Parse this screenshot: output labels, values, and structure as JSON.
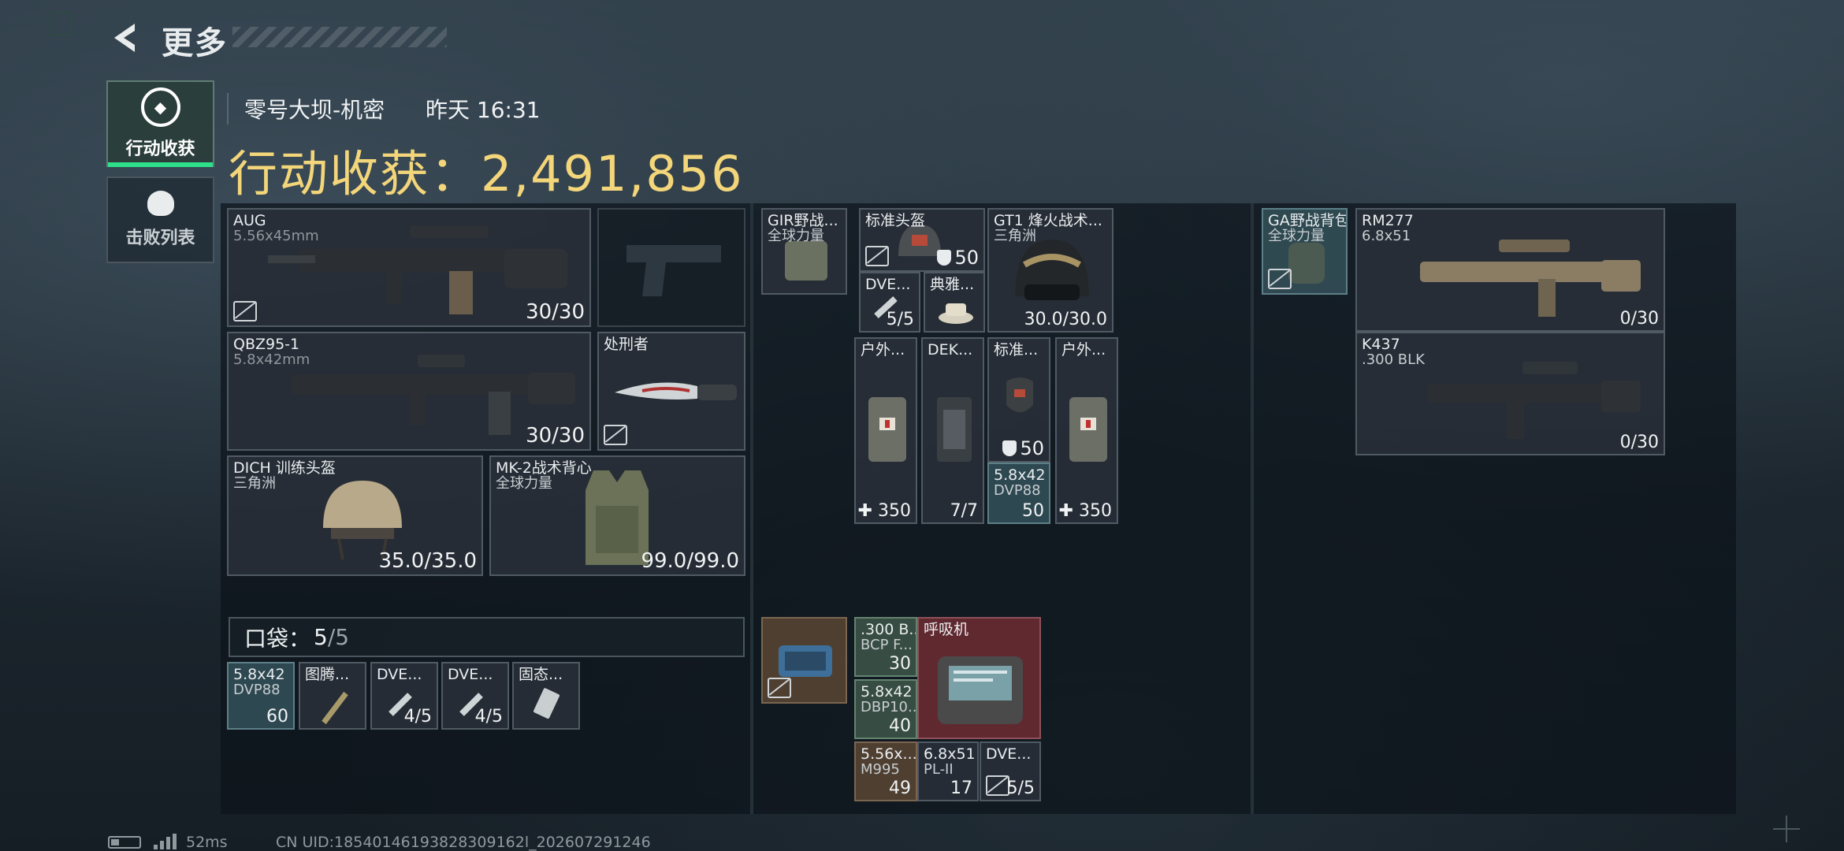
{
  "header": {
    "title": "更多"
  },
  "sidebar": {
    "tabs": [
      {
        "label": "行动收获",
        "active": true
      },
      {
        "label": "击败列表",
        "active": false
      }
    ]
  },
  "match": {
    "map": "零号大坝-机密",
    "time": "昨天 16:31"
  },
  "loot": {
    "label": "行动收获：",
    "value": "2,491,856"
  },
  "colors": {
    "accent": "#2fe08a",
    "gold": "#f3d57a",
    "red_slot": "#6e2d32"
  },
  "loadout": {
    "primary_1": {
      "name": "AUG",
      "caliber": "5.56x45mm",
      "ammo": "30/30"
    },
    "primary_2": {
      "name": "QBZ95-1",
      "caliber": "5.8x42mm",
      "ammo": "30/30"
    },
    "melee": {
      "name": "处刑者"
    },
    "helmet": {
      "name": "DICH 训练头盔",
      "brand": "三角洲",
      "durability": "35.0/35.0"
    },
    "armor": {
      "name": "MK-2战术背心",
      "brand": "全球力量",
      "durability": "99.0/99.0"
    }
  },
  "pocket": {
    "label": "口袋：",
    "value": "5",
    "max": "/5",
    "items": [
      {
        "name": "5.8x42",
        "sub": "DVP88",
        "count": "60"
      },
      {
        "name": "图腾...",
        "sub": "",
        "count": ""
      },
      {
        "name": "DVE...",
        "sub": "",
        "count": "4/5"
      },
      {
        "name": "DVE...",
        "sub": "",
        "count": "4/5"
      },
      {
        "name": "固态...",
        "sub": "",
        "count": ""
      }
    ]
  },
  "chest": {
    "rig": {
      "name": "GIR野战...",
      "brand": "全球力量"
    },
    "helmet_std": {
      "name": "标准头盔",
      "armor": "50"
    },
    "gt1": {
      "name": "GT1 烽火战术...",
      "brand": "三角洲",
      "durability": "30.0/30.0"
    },
    "dve": {
      "name": "DVE...",
      "count": "5/5"
    },
    "dianya": {
      "name": "典雅..."
    },
    "kits": [
      {
        "name": "户外...",
        "count": "350"
      },
      {
        "name": "DEK...",
        "count": "7/7"
      },
      {
        "name": "标准...",
        "armor": "50",
        "ammo_name": "5.8x42",
        "ammo_sub": "DVP88",
        "count": "50"
      },
      {
        "name": "户外...",
        "count": "350"
      }
    ]
  },
  "secure": {
    "case": {
      "name": "",
      "sub": ""
    },
    "ammo_300": {
      "name": ".300 B...",
      "sub": "BCP F...",
      "count": "30"
    },
    "respirator": {
      "name": "呼吸机"
    },
    "ammo_58": {
      "name": "5.8x42",
      "sub": "DBP10...",
      "count": "40"
    },
    "small": [
      {
        "name": "5.56x...",
        "sub": "M995",
        "count": "49"
      },
      {
        "name": "6.8x51",
        "sub": "PL-II",
        "count": "17"
      },
      {
        "name": "DVE...",
        "sub": "",
        "count": "5/5"
      }
    ]
  },
  "backpack": {
    "bag": {
      "name": "GA野战背包",
      "brand": "全球力量"
    },
    "weapons": [
      {
        "name": "RM277",
        "caliber": "6.8x51",
        "ammo": "0/30"
      },
      {
        "name": "K437",
        "caliber": ".300 BLK",
        "ammo": "0/30"
      }
    ]
  },
  "status": {
    "ping": "52ms",
    "uid": "CN UID:18540146193828309162l_202607291246"
  }
}
